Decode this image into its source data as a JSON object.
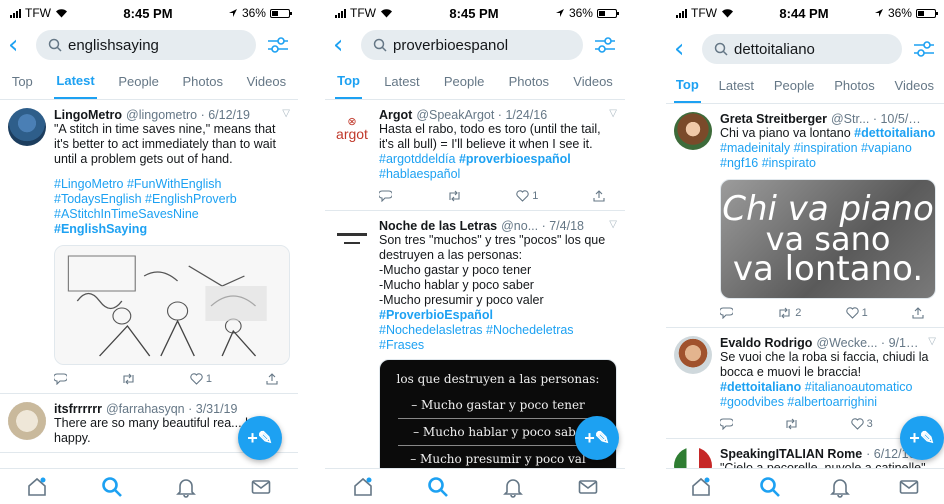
{
  "status": [
    {
      "carrier": "TFW",
      "time": "8:45 PM",
      "battery": "36%"
    },
    {
      "carrier": "TFW",
      "time": "8:45 PM",
      "battery": "36%"
    },
    {
      "carrier": "TFW",
      "time": "8:44 PM",
      "battery": "36%"
    }
  ],
  "search": [
    "englishsaying",
    "proverbioespanol",
    "dettoitaliano"
  ],
  "tabs": [
    "Top",
    "Latest",
    "People",
    "Photos",
    "Videos"
  ],
  "active_tab": [
    "Latest",
    "Top",
    "Top"
  ],
  "screen1": {
    "t1": {
      "name": "LingoMetro",
      "handle": "@lingometro · 6/12/19",
      "text": "\"A stitch in time saves nine,\" means that it's better to act immediately than to wait until a problem gets out of hand.",
      "tags1": "#LingoMetro #FunWithEnglish #TodaysEnglish #EnglishProverb #AStitchInTimeSavesNine",
      "tags2": "#EnglishSaying",
      "like": "1"
    },
    "t2": {
      "name": "itsfrrrrrr",
      "handle": "@farrahasyqn · 3/31/19",
      "text": "There are so many beautiful rea... be happy."
    }
  },
  "screen2": {
    "t1": {
      "name": "Argot",
      "handle": "@SpeakArgot · 1/24/16",
      "logo": "argot",
      "text": "Hasta el rabo, todo es toro (until the tail, it's all bull) = I'll believe it when I see it. ",
      "tag_a": "#argotddeldía",
      "tag_b": "#proverbioespañol",
      "tag_c": " #hablaespañol",
      "like": "1"
    },
    "t2": {
      "name": "Noche de las Letras",
      "handle": "@no... · 7/4/18",
      "lines": [
        "Son tres \"muchos\" y tres \"pocos\" los que destruyen a las personas:",
        "-Mucho gastar y poco tener",
        "-Mucho hablar y poco saber",
        "-Mucho presumir y poco valer"
      ],
      "tag_b": "#ProverbioEspañol",
      "tags": "#Nochedelasletras #Nochedeletras #Frases",
      "card": [
        "los que destruyen a las personas:",
        "– Mucho gastar y poco tener",
        "– Mucho hablar y poco sabe",
        "– Mucho presumir y poco val"
      ]
    }
  },
  "screen3": {
    "t1": {
      "name": "Greta Streitberger",
      "handle": "@Str... · 10/5/16",
      "text": "Chi va piano va lontano ",
      "tag_b": "#dettoitaliano",
      "tags": " #madeinitaly #inspiration #vapiano #ngf16 #inspirato",
      "card": [
        "Chi va piano",
        "va sano",
        "va lontano."
      ],
      "retweet": "2",
      "like": "1"
    },
    "t2": {
      "name": "Evaldo Rodrigo",
      "handle": "@Wecke... · 9/16/16",
      "text": "Se vuoi che la roba si faccia, chiudi la bocca e muovi le braccia! ",
      "tag_b": "#dettoitaliano",
      "tags": " #italianoautomatico #goodvibes #albertoarrighini",
      "like": "3"
    },
    "t3": {
      "name": "SpeakingITALIAN Rome",
      "handle": "· 6/12/16",
      "text": "\"Cielo a pecorelle, nuvole a catinelle\""
    }
  },
  "colors": {
    "accent": "#1da1f2",
    "text": "#14171a",
    "muted": "#657786"
  },
  "icons": [
    "home-icon",
    "search-icon",
    "bell-icon",
    "mail-icon",
    "compose-icon"
  ]
}
